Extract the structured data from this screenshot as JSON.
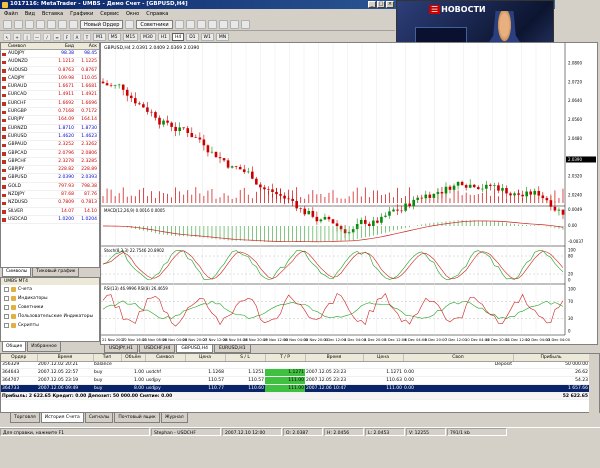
{
  "window": {
    "title": "1017116: MetaTrader - UMBS - Демо Счет - [GBPUSD,H4]"
  },
  "menu": [
    "Файл",
    "Вид",
    "Вставка",
    "Графики",
    "Сервис",
    "Окно",
    "Справка"
  ],
  "toolbar": {
    "new_order": "Новый Ордер",
    "advisors": "Советники"
  },
  "timeframes": [
    "M1",
    "M5",
    "M15",
    "M30",
    "H1",
    "H4",
    "D1",
    "W1",
    "MN"
  ],
  "active_tf": "H4",
  "video": {
    "logo": "НОВОСТИ",
    "name_bar": "ИРИНА ГЛЕБОВА",
    "ticker1": "Акции ФБ ММВБ     Индекс ММВБ 1928.39",
    "ticker2": "Голубков. Чемпионат мира. Женщины. Четвертьфинал. Ве"
  },
  "market_watch": {
    "headers": [
      "Символ",
      "Бид",
      "Аск"
    ],
    "rows": [
      {
        "s": "AUDJPY",
        "bid": "98.38",
        "ask": "98.45",
        "c": "b"
      },
      {
        "s": "AUDNZD",
        "bid": "1.1213",
        "ask": "1.1225",
        "c": "r"
      },
      {
        "s": "AUDUSD",
        "bid": "0.8763",
        "ask": "0.8767",
        "c": "r"
      },
      {
        "s": "CADJPY",
        "bid": "109.98",
        "ask": "110.05",
        "c": "r"
      },
      {
        "s": "EURAUD",
        "bid": "1.6671",
        "ask": "1.6681",
        "c": "r"
      },
      {
        "s": "EURCAD",
        "bid": "1.4911",
        "ask": "1.4921",
        "c": "r"
      },
      {
        "s": "EURCHF",
        "bid": "1.6692",
        "ask": "1.6696",
        "c": "r"
      },
      {
        "s": "EURGBP",
        "bid": "0.7168",
        "ask": "0.7172",
        "c": "r"
      },
      {
        "s": "EURJPY",
        "bid": "164.09",
        "ask": "164.14",
        "c": "r"
      },
      {
        "s": "EURNZD",
        "bid": "1.8710",
        "ask": "1.8730",
        "c": "b"
      },
      {
        "s": "EURUSD",
        "bid": "1.4620",
        "ask": "1.4623",
        "c": "b"
      },
      {
        "s": "GBPAUD",
        "bid": "2.3252",
        "ask": "2.3262",
        "c": "r"
      },
      {
        "s": "GBPCAD",
        "bid": "2.0796",
        "ask": "2.0806",
        "c": "r"
      },
      {
        "s": "GBPCHF",
        "bid": "2.3278",
        "ask": "2.3285",
        "c": "r"
      },
      {
        "s": "GBPJPY",
        "bid": "228.82",
        "ask": "228.89",
        "c": "r"
      },
      {
        "s": "GBPUSD",
        "bid": "2.0390",
        "ask": "2.0393",
        "c": "b"
      },
      {
        "s": "GOLD",
        "bid": "797.93",
        "ask": "798.38",
        "c": "r"
      },
      {
        "s": "NZDJPY",
        "bid": "87.68",
        "ask": "87.76",
        "c": "r"
      },
      {
        "s": "NZDUSD",
        "bid": "0.7809",
        "ask": "0.7813",
        "c": "r"
      },
      {
        "s": "SILVER",
        "bid": "14.07",
        "ask": "14.10",
        "c": "r"
      },
      {
        "s": "USDCAD",
        "bid": "1.0200",
        "ask": "1.0204",
        "c": "b"
      }
    ],
    "tabs": [
      "Символы",
      "Тиковый график"
    ]
  },
  "navigator": {
    "title": "UMBS MT4",
    "items": [
      "Счета",
      "Индикаторы",
      "Советники",
      "Пользовательские Индикаторы",
      "Скрипты"
    ],
    "tabs": [
      "Общие",
      "Избранное"
    ]
  },
  "chart": {
    "title": "GBPUSD,H4  2.0391 2.0409 2.0369 2.0390",
    "macd_label": "MACD(12,26,9) 0.0016 0.0005",
    "stoch_label": "Stoch(8,3,3) 22.7546 20.8902",
    "rsi_label": "RSI(13) 46.9996  RSI(8) 26.4659",
    "price_axis": [
      "2.0800",
      "2.0720",
      "2.0640",
      "2.0560",
      "2.0480",
      "2.0390",
      "2.0320",
      "2.0240"
    ],
    "current_price": "2.0390",
    "macd_axis": [
      "0.0049",
      "0.00",
      "-0.0037"
    ],
    "stoch_axis": [
      "100",
      "80",
      "20",
      "0"
    ],
    "rsi_axis": [
      "100",
      "70",
      "30",
      "0"
    ],
    "time_axis": [
      "21 Nov 2007",
      "22 Nov 16:00",
      "23 Nov 08:00",
      "26 Nov 04:00",
      "26 Nov 20:00",
      "27 Nov 12:00",
      "28 Nov 04:00",
      "28 Nov 20:00",
      "29 Nov 12:00",
      "30 Nov 04:00",
      "30 Nov 20:00",
      "3 Dec 12:00",
      "4 Dec 04:00",
      "4 Dec 20:00",
      "5 Dec 12:00",
      "6 Dec 04:00",
      "6 Dec 20:00",
      "7 Dec 12:00",
      "10 Dec 04:00",
      "10 Dec 20:00",
      "11 Dec 12:00",
      "12 Dec 04:00",
      "13 Dec 04:00"
    ],
    "tabs": [
      "USDJPY,H1",
      "USDCHF,H4",
      "GBPUSD,H4",
      "EURUSD,H1"
    ],
    "active_tab": "GBPUSD,H4"
  },
  "terminal": {
    "headers": [
      "Ордер",
      "Время",
      "Тип",
      "Объём",
      "Символ",
      "Цена",
      "S / L",
      "T / P",
      "Время",
      "Цена",
      "Своп",
      "Прибыль"
    ],
    "rows": [
      [
        "356329",
        "2007.12.02 20:21",
        "balance",
        "",
        "",
        "",
        "",
        "",
        "",
        "",
        "Deposit",
        "50 000.00"
      ],
      [
        "364643",
        "2007.12.05 22:57",
        "buy",
        "1.00",
        "usdchf",
        "1.1268",
        "1.1251",
        "1.1271",
        "2007.12.05 23:23",
        "1.1271",
        "0.00",
        "26.62"
      ],
      [
        "364707",
        "2007.12.05 23:19",
        "buy",
        "1.00",
        "usdjpy",
        "110.57",
        "110.57",
        "111.00",
        "2007.12.05 23:23",
        "110.63",
        "0.00",
        "54.23"
      ],
      [
        "364733",
        "2007.12.06 09:49",
        "buy",
        "8.00",
        "usdjpy",
        "110.77",
        "110.60",
        "111.00",
        "2007.12.06 10:47",
        "111.00",
        "0.00",
        "1 657.66"
      ]
    ],
    "summary": "Прибыль: 2 622.65  Кредит: 0.00  Депозит: 50 000.00  Снятие: 0.00",
    "total": "52 622.65",
    "tabs": [
      "Торговля",
      "История Счета",
      "Сигналы",
      "Почтовый ящик",
      "Журнал"
    ],
    "active_tab": "История Счета"
  },
  "status": [
    "Для справки, нажмите F1",
    "Stephan - USDCHF",
    "2007.12.10 12:00",
    "O: 2.0387",
    "H: 2.0456",
    "L: 2.0453",
    "V: 12255",
    "791/1 kb"
  ],
  "colors": {
    "bull": "#0a8a0a",
    "bear": "#cc0000",
    "accent": "#0a246a",
    "tp_bg": "#40c040"
  }
}
